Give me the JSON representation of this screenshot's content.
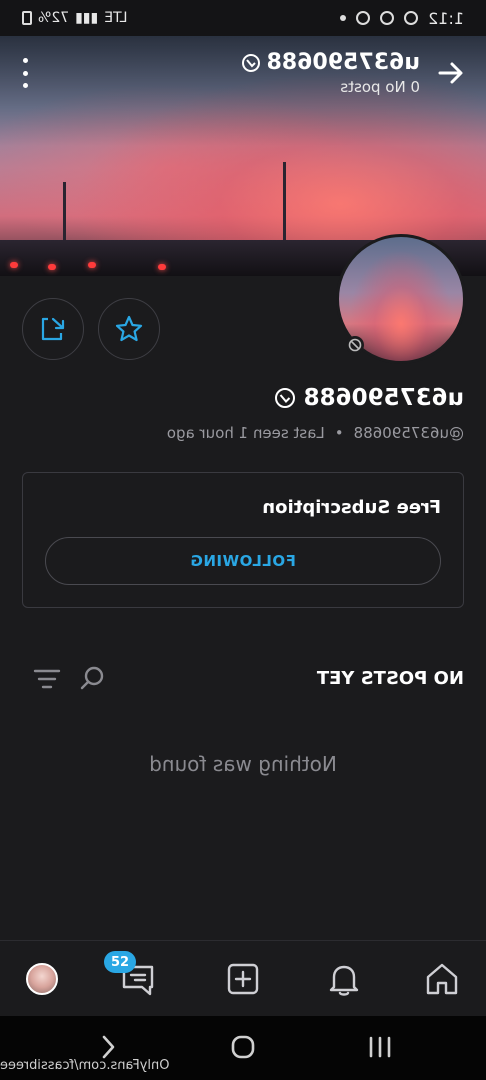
{
  "status_bar": {
    "time": "1:12",
    "battery": "72%",
    "network": "LTE"
  },
  "header": {
    "username": "u637590688",
    "posts_count": "0 No posts"
  },
  "profile": {
    "name": "u637590688",
    "handle": "@u637590688",
    "separator": "•",
    "last_seen": "Last seen 1 hour ago"
  },
  "subscription": {
    "title": "Free Subscription",
    "button_label": "FOLLOWING"
  },
  "posts": {
    "title": "NO POSTS YET",
    "empty_message": "Nothing was found"
  },
  "bottom_nav": {
    "messages_badge": "52"
  },
  "watermark": "OnlyFans.com/fcassibreee",
  "colors": {
    "accent": "#2aa7e4",
    "background": "#1b1b1d"
  }
}
